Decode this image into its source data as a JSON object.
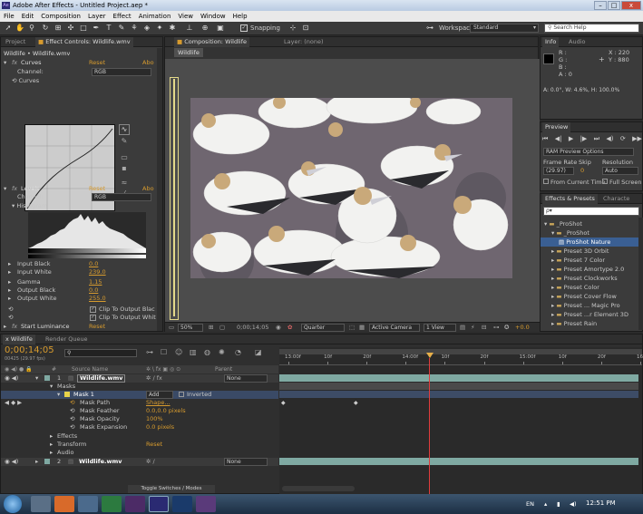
{
  "window": {
    "title": "Adobe After Effects - Untitled Project.aep *",
    "app_icon": "Ae",
    "buttons": [
      "–",
      "□",
      "x"
    ]
  },
  "menu": [
    "File",
    "Edit",
    "Composition",
    "Layer",
    "Effect",
    "Animation",
    "View",
    "Window",
    "Help"
  ],
  "toolbar": {
    "snapping": "Snapping",
    "workspace_label": "Workspace:",
    "workspace_value": "Standard",
    "search_placeholder": "Search Help"
  },
  "left_panel": {
    "tab_project": "Project",
    "tab_effect_controls": "Effect Controls: Wildlife.wmv",
    "breadcrumb": "Wildlife • Wildlife.wmv",
    "curves": {
      "name": "Curves",
      "reset": "Reset",
      "about": "Abo",
      "channel_label": "Channel:",
      "channel_value": "RGB",
      "sub": "Curves"
    },
    "levels": {
      "name": "Levels",
      "reset": "Reset",
      "about": "Abo",
      "channel_label": "Channel:",
      "channel_value": "RGB",
      "histogram": "Histogram"
    },
    "params": [
      {
        "label": "Input Black",
        "value": "0.0"
      },
      {
        "label": "Input White",
        "value": "239.0"
      },
      {
        "label": "Gamma",
        "value": "1.15"
      },
      {
        "label": "Output Black",
        "value": "0.0"
      },
      {
        "label": "Output White",
        "value": "255.0"
      }
    ],
    "clip_black": "Clip To Output Blac",
    "clip_white": "Clip To Output Whit",
    "start_luminance": {
      "name": "Start Luminance",
      "reset": "Reset"
    }
  },
  "comp_panel": {
    "tab": "Composition: Wildlife",
    "layer_tab": "Layer: (none)",
    "comp_name": "Wildlife",
    "zoom": "50%",
    "timecode": "0;00;14;05",
    "resolution": "Quarter",
    "camera": "Active Camera",
    "view": "1 View",
    "exposure": "+0.0"
  },
  "info_panel": {
    "tab_info": "Info",
    "tab_audio": "Audio",
    "r": "R :",
    "g": "G :",
    "b": "B :",
    "a": "A : 0",
    "x": "X : 220",
    "y": "Y : 880",
    "hsb": "A: 0.0°, W: 4.6%, H: 100.0%"
  },
  "preview_panel": {
    "tab": "Preview",
    "ram_options": "RAM Preview Options",
    "frame_rate_label": "Frame Rate",
    "skip_label": "Skip",
    "resolution_label": "Resolution",
    "frame_rate": "(29.97)",
    "skip": "0",
    "resolution": "Auto",
    "from_current": "From Current Time",
    "full_screen": "Full Screen"
  },
  "effects_panel": {
    "tab": "Effects & Presets",
    "tab2": "Characte",
    "search_placeholder": "ρ▾",
    "items": [
      {
        "label": "_ProShot",
        "level": 0,
        "open": true,
        "type": "folder"
      },
      {
        "label": "_ProShot",
        "level": 1,
        "open": true,
        "type": "folder"
      },
      {
        "label": "ProShot Nature",
        "level": 2,
        "type": "preset",
        "selected": true
      },
      {
        "label": "Preset 3D Orbit",
        "level": 1,
        "type": "folder"
      },
      {
        "label": "Preset 7 Color",
        "level": 1,
        "type": "folder"
      },
      {
        "label": "Preset Amortype 2.0",
        "level": 1,
        "type": "folder"
      },
      {
        "label": "Preset Clockworks",
        "level": 1,
        "type": "folder"
      },
      {
        "label": "Preset Color",
        "level": 1,
        "type": "folder"
      },
      {
        "label": "Preset Cover Flow",
        "level": 1,
        "type": "folder"
      },
      {
        "label": "Preset ... Magic Pro",
        "level": 1,
        "type": "folder"
      },
      {
        "label": "Preset ...r Element 3D",
        "level": 1,
        "type": "folder"
      },
      {
        "label": "Preset Rain",
        "level": 1,
        "type": "folder"
      }
    ]
  },
  "timeline": {
    "tab_comp": "Wildlife",
    "tab_render": "Render Queue",
    "timecode": "0;00;14;05",
    "fps_info": "00425 (29.97 fps)",
    "col_source": "Source Name",
    "col_parent": "Parent",
    "ruler": [
      "13:00f",
      "10f",
      "20f",
      "14:00f",
      "10f",
      "20f",
      "15:00f",
      "10f",
      "20f",
      "16:0"
    ],
    "layer1": {
      "num": "1",
      "name": "Wildlife.wmv",
      "parent": "None"
    },
    "masks": "Masks",
    "mask1": "Mask 1",
    "mask_mode": "Add",
    "inverted": "Inverted",
    "mask_path": "Mask Path",
    "mask_path_val": "Shape...",
    "mask_feather": "Mask Feather",
    "mask_feather_val": "0.0,0.0 pixels",
    "mask_opacity": "Mask Opacity",
    "mask_opacity_val": "100%",
    "mask_expansion": "Mask Expansion",
    "mask_expansion_val": "0.0 pixels",
    "effects": "Effects",
    "transform": "Transform",
    "transform_reset": "Reset",
    "audio": "Audio",
    "layer2": {
      "num": "2",
      "name": "Wildlife.wmv",
      "parent": "None"
    },
    "toggle": "Toggle Switches / Modes"
  },
  "taskbar": {
    "lang": "EN",
    "time": "12:51 PM"
  },
  "colors": {
    "accent": "#d79b2e",
    "bar_teal": "#7fa9a2",
    "cti": "#e23c3c",
    "selected_blue": "#3a5f93"
  }
}
